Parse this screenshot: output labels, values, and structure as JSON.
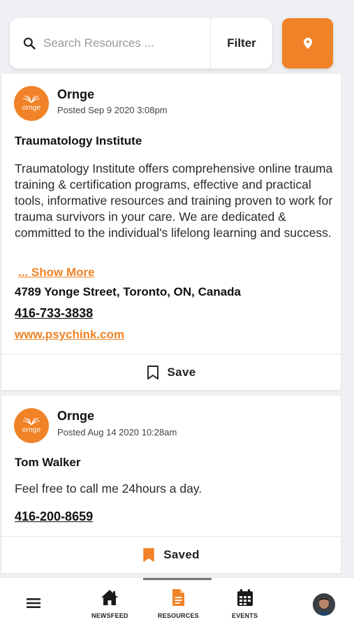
{
  "search": {
    "placeholder": "Search Resources ...",
    "value": ""
  },
  "filter_label": "Filter",
  "posts": [
    {
      "author": "Ornge",
      "logo_text": "ornge",
      "posted": "Posted Sep 9 2020 3:08pm",
      "title": "Traumatology Institute",
      "description": "Traumatology Institute offers comprehensive online trauma training & certification programs, effective and practical tools, informative resources and training proven to work for trauma survivors in your care. We are dedicated & committed to the individual's lifelong learning and success.",
      "show_more": "... Show More",
      "address": "4789 Yonge Street, Toronto, ON, Canada",
      "phone": "416-733-3838",
      "website": "www.psychink.com",
      "save_label": "Save",
      "saved": false
    },
    {
      "author": "Ornge",
      "logo_text": "ornge",
      "posted": "Posted Aug 14 2020 10:28am",
      "title": "Tom Walker",
      "description": "Feel free to call me 24hours a day.",
      "phone": "416-200-8659",
      "save_label": "Saved",
      "saved": true
    }
  ],
  "nav": {
    "items": [
      {
        "label": "NEWSFEED",
        "icon": "home-icon"
      },
      {
        "label": "RESOURCES",
        "icon": "document-icon",
        "active": true
      },
      {
        "label": "EVENTS",
        "icon": "calendar-icon"
      }
    ]
  },
  "colors": {
    "accent": "#f08327",
    "background": "#eef0f3"
  }
}
